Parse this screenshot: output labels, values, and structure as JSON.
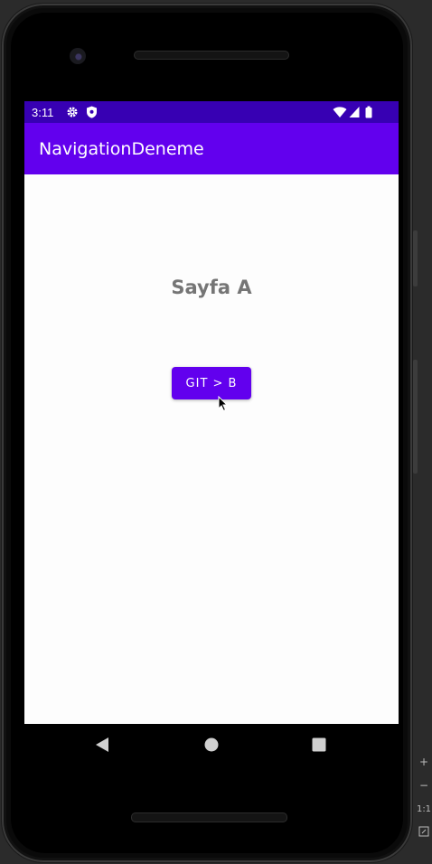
{
  "status_bar": {
    "time": "3:11",
    "icons_left": [
      "gear-icon",
      "shield-icon"
    ],
    "icons_right": [
      "wifi-icon",
      "signal-icon",
      "battery-icon"
    ],
    "color": "#3700b3"
  },
  "app_bar": {
    "title": "NavigationDeneme",
    "color": "#6200ee"
  },
  "main": {
    "title": "Sayfa A",
    "button_label": "GIT > B"
  },
  "nav_bar": {
    "buttons": [
      "back-icon",
      "home-icon",
      "recents-icon"
    ]
  },
  "ide_controls": {
    "zoom_in": "+",
    "zoom_out": "−",
    "actual_size": "1:1"
  }
}
